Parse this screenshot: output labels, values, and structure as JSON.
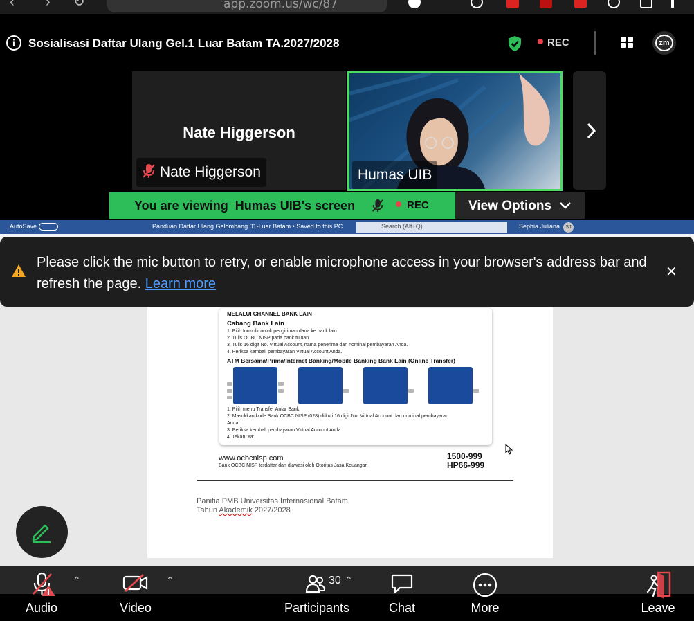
{
  "browser": {
    "url": "app.zoom.us/wc/87"
  },
  "meeting": {
    "title": "Sosialisasi Daftar Ulang Gel.1 Luar Batam TA.2027/2028",
    "rec_label": "REC",
    "zm_label": "zm"
  },
  "participants_strip": {
    "tile1": {
      "big_name": "Nate Higgerson",
      "chip_name": "Nate Higgerson"
    },
    "tile2": {
      "chip_name": "Humas UIB"
    }
  },
  "viewing": {
    "text": "You are viewing  Humas UIB's screen",
    "rec_label": "REC",
    "view_options": "View Options"
  },
  "word": {
    "autosave": "AutoSave",
    "doc_title": "Panduan Daftar Ulang Gelombang 01-Luar Batam • Saved to this PC",
    "search": "Search (Alt+Q)",
    "user": "Sephia Juliana",
    "initials": "SJ"
  },
  "document": {
    "bank_heading": "MELALUI CHANNEL BANK LAIN",
    "bank_subheading": "Cabang Bank Lain",
    "bank_steps": [
      "1.   Pilih formulir untuk pengiriman dana ke bank lain.",
      "2.   Tulis OCBC NISP pada bank tujuan.",
      "3.   Tulis 16 digit No. Virtual Account, nama penerima dan nominal pembayaran Anda.",
      "4.   Periksa kembali pembayaran Virtual Account Anda."
    ],
    "atm_heading": "ATM Bersama/Prima/Internet Banking/Mobile Banking Bank Lain (Online Transfer)",
    "atm_steps": [
      "1.   Pilih menu Transfer Antar Bank.",
      "2.   Masukkan kode Bank OCBC NISP (028) diikuti 16 digit No. Virtual Account dan nominal pembayaran",
      "       Anda.",
      "3.   Periksa kembali pembayaran Virtual Account Anda.",
      "4.   Tekan 'Ya'."
    ],
    "website": "www.ocbcnisp.com",
    "note": "Bank OCBC NISP terdaftar dan diawasi oleh Otoritas Jasa Keuangan",
    "phone1": "1500-999",
    "phone2": "HP66-999",
    "footer_line1": "Panitia PMB Universitas Internasional Batam",
    "footer_line2_a": "Tahun ",
    "footer_line2_b": "Akademik",
    "footer_line2_c": " 2027/2028"
  },
  "banner": {
    "message": "Please click the mic button to retry, or enable microphone access in your browser's address bar and refresh the page.",
    "learn_more": "Learn more"
  },
  "toolbar": {
    "audio": "Audio",
    "video": "Video",
    "participants": "Participants",
    "participant_count": "30",
    "chat": "Chat",
    "more": "More",
    "leave": "Leave"
  },
  "colors": {
    "accent_green": "#2dbd59",
    "active_speaker_border": "#4cd964",
    "rec_red": "#e8424a",
    "link_blue": "#4f9dff",
    "leave_red": "#e5484d"
  }
}
